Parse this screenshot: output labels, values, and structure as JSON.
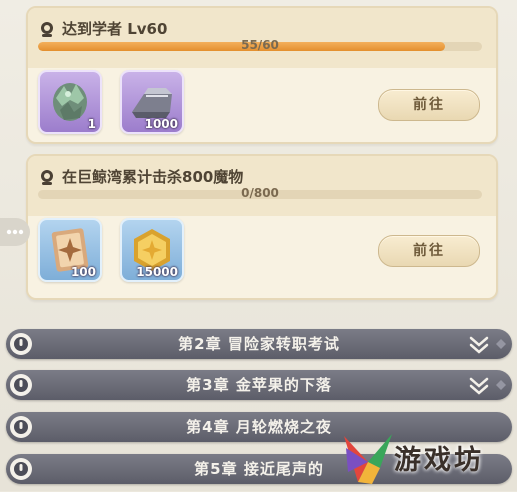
{
  "quests": [
    {
      "title": "达到学者 Lv60",
      "progress_text": "55/60",
      "progress_fraction": 0.917,
      "rewards": [
        {
          "icon": "green-crystal-cluster-icon",
          "quantity": "1",
          "rarity": "purple"
        },
        {
          "icon": "silver-ingot-icon",
          "quantity": "1000",
          "rarity": "purple"
        }
      ],
      "button_label": "前往"
    },
    {
      "title": "在巨鲸湾累计击杀800魔物",
      "progress_text": "0/800",
      "progress_fraction": 0,
      "rewards": [
        {
          "icon": "star-scroll-card-icon",
          "quantity": "100",
          "rarity": "blue"
        },
        {
          "icon": "gold-coin-icon",
          "quantity": "15000",
          "rarity": "blue"
        }
      ],
      "button_label": "前往"
    }
  ],
  "chapters": [
    {
      "label": "第2章  冒险家转职考试"
    },
    {
      "label": "第3章  金苹果的下落"
    },
    {
      "label": "第4章  月轮燃烧之夜"
    },
    {
      "label": "第5章  接近尾声的"
    }
  ],
  "watermark": {
    "text": "游戏坊"
  },
  "colors": {
    "progress_fill": "#e8962f",
    "chapter_bar": "#666773",
    "card_bg": "#f8f2e2"
  }
}
